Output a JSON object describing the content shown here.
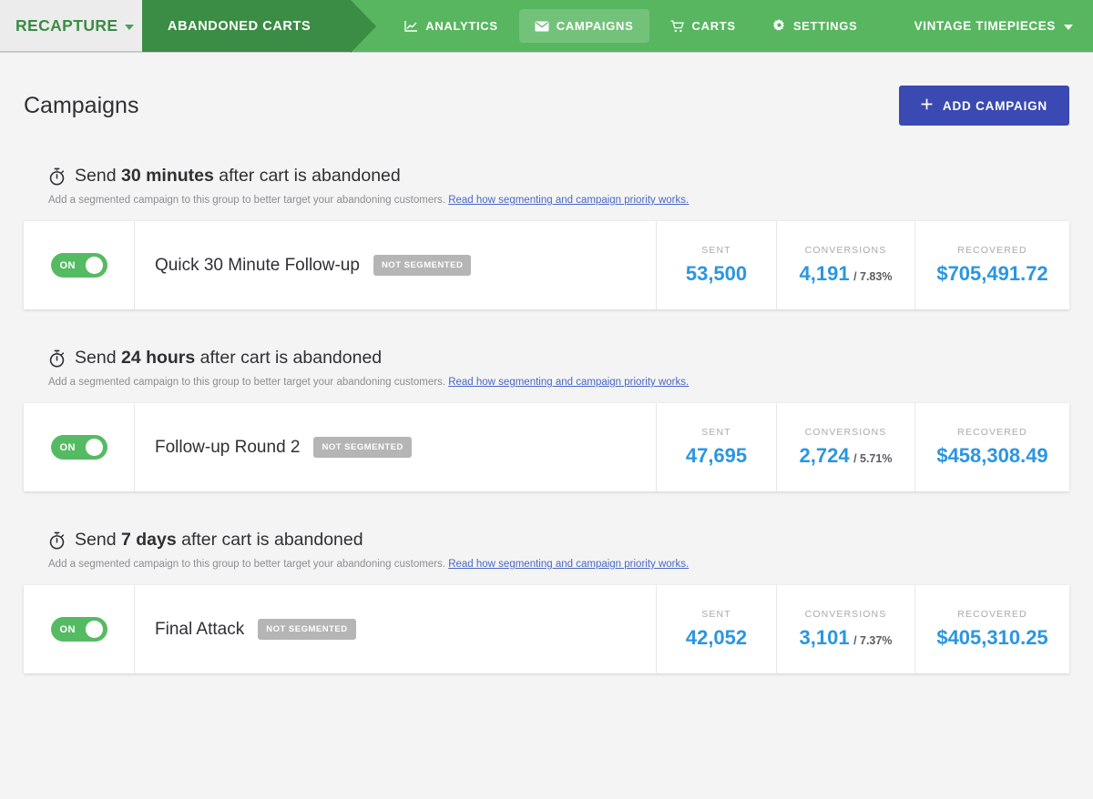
{
  "navbar": {
    "brand": "RECAPTURE",
    "brand_caret_icon": "chevron-down-icon",
    "active_tab": "ABANDONED CARTS",
    "links": [
      {
        "label": "ANALYTICS",
        "icon": "chart-line-icon",
        "selected": false
      },
      {
        "label": "CAMPAIGNS",
        "icon": "envelope-icon",
        "selected": true
      },
      {
        "label": "CARTS",
        "icon": "shopping-cart-icon",
        "selected": false
      },
      {
        "label": "SETTINGS",
        "icon": "gear-icon",
        "selected": false
      }
    ],
    "account": "VINTAGE TIMEPIECES",
    "account_caret_icon": "chevron-down-icon",
    "colors": {
      "bar": "#57b65f",
      "active_tab": "#3b8c44",
      "brand_bg": "#ececec",
      "brand_text": "#3a8c43"
    }
  },
  "header": {
    "title": "Campaigns",
    "add_button": {
      "label": "ADD CAMPAIGN",
      "icon": "plus-icon",
      "color": "#3b49b2"
    }
  },
  "groups": [
    {
      "title_prefix": "Send",
      "title_delay": "30 minutes",
      "title_suffix": "after cart is abandoned",
      "clock_icon": "stopwatch-icon",
      "subtitle": "Add a segmented campaign to this group to better target your abandoning customers.",
      "subtitle_link": "Read how segmenting and campaign priority works.",
      "campaigns": [
        {
          "toggle_state": "ON",
          "name": "Quick 30 Minute Follow-up",
          "badge": "NOT SEGMENTED",
          "sent_label": "SENT",
          "sent_value": "53,500",
          "conversions_label": "CONVERSIONS",
          "conversions_value": "4,191",
          "conversions_rate": "/ 7.83%",
          "recovered_label": "RECOVERED",
          "recovered_value": "$705,491.72"
        }
      ]
    },
    {
      "title_prefix": "Send",
      "title_delay": "24 hours",
      "title_suffix": "after cart is abandoned",
      "clock_icon": "stopwatch-icon",
      "subtitle": "Add a segmented campaign to this group to better target your abandoning customers.",
      "subtitle_link": "Read how segmenting and campaign priority works.",
      "campaigns": [
        {
          "toggle_state": "ON",
          "name": "Follow-up Round 2",
          "badge": "NOT SEGMENTED",
          "sent_label": "SENT",
          "sent_value": "47,695",
          "conversions_label": "CONVERSIONS",
          "conversions_value": "2,724",
          "conversions_rate": "/ 5.71%",
          "recovered_label": "RECOVERED",
          "recovered_value": "$458,308.49"
        }
      ]
    },
    {
      "title_prefix": "Send",
      "title_delay": "7 days",
      "title_suffix": "after cart is abandoned",
      "clock_icon": "stopwatch-icon",
      "subtitle": "Add a segmented campaign to this group to better target your abandoning customers.",
      "subtitle_link": "Read how segmenting and campaign priority works.",
      "campaigns": [
        {
          "toggle_state": "ON",
          "name": "Final Attack",
          "badge": "NOT SEGMENTED",
          "sent_label": "SENT",
          "sent_value": "42,052",
          "conversions_label": "CONVERSIONS",
          "conversions_value": "3,101",
          "conversions_rate": "/ 7.37%",
          "recovered_label": "RECOVERED",
          "recovered_value": "$405,310.25"
        }
      ]
    }
  ]
}
